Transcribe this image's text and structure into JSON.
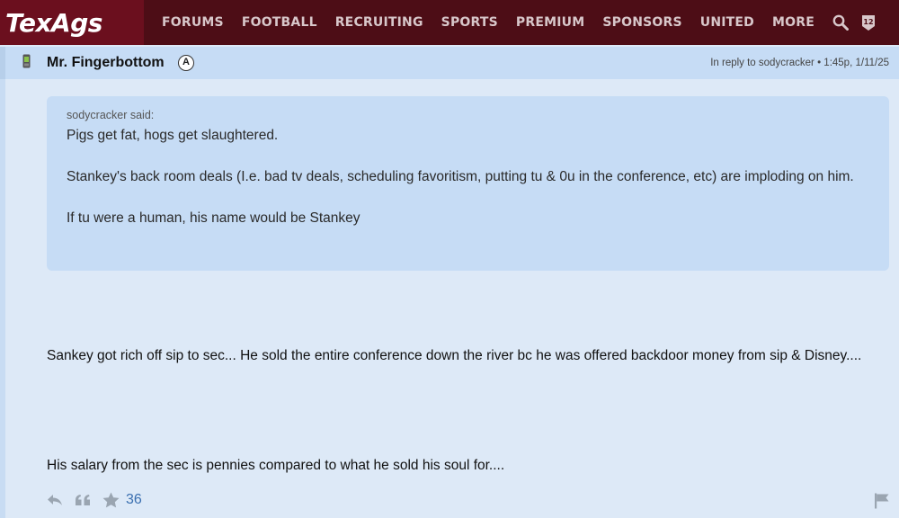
{
  "site": {
    "logo": "TexAgs"
  },
  "nav": {
    "items": [
      "FORUMS",
      "FOOTBALL",
      "RECRUITING",
      "SPORTS",
      "PREMIUM",
      "SPONSORS",
      "UNITED",
      "MORE"
    ],
    "icons": [
      "search-icon",
      "12th-man-icon"
    ]
  },
  "post": {
    "author": "Mr. Fingerbottom",
    "badge": "A",
    "reply_info": "In reply to sodycracker • 1:45p, 1/11/25",
    "quote": {
      "author_line": "sodycracker said:",
      "lines": [
        "Pigs get fat, hogs get slaughtered.",
        "Stankey's back room deals (I.e. bad tv deals, scheduling favoritism, putting tu & 0u in the conference, etc) are imploding on him.",
        "If tu were a human, his name would be Stankey"
      ]
    },
    "body": [
      "Sankey got rich off sip to sec... He sold the entire conference down the river bc he was offered backdoor money from sip & Disney....",
      "His salary from the sec is pennies compared to what he sold his soul for...."
    ],
    "likes": "36"
  },
  "colors": {
    "nav_bg": "#4d0d16",
    "logo_bg": "#6b0f1e",
    "post_bg": "#dde9f7",
    "quote_bg": "#c6dcf5",
    "link": "#3a6fb0"
  }
}
